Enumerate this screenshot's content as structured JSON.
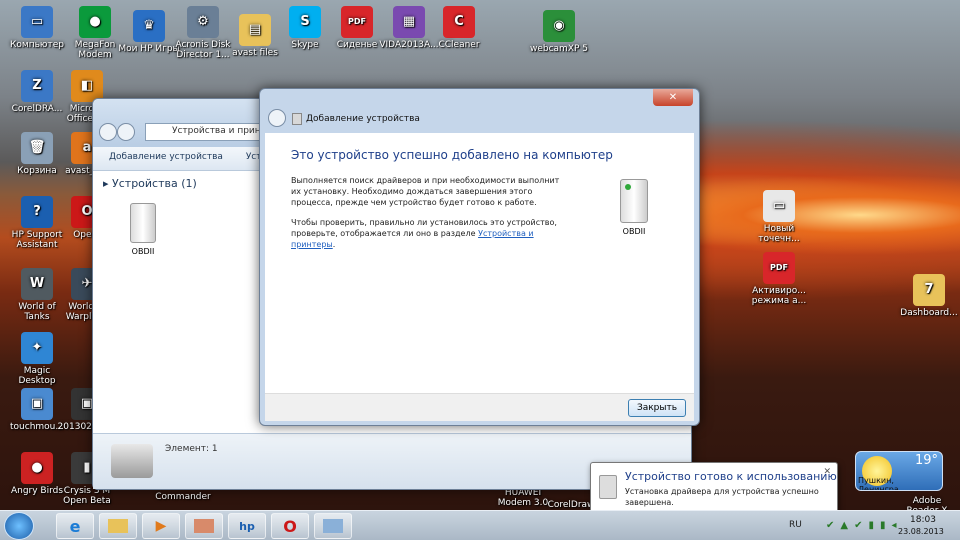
{
  "desktop": {
    "icons": [
      {
        "id": "computer",
        "label": "Компьютер",
        "color": "#3b78c6",
        "glyph": "▭"
      },
      {
        "id": "megafon",
        "label": "MegaFon Modem",
        "color": "#0b9a3c",
        "glyph": "●"
      },
      {
        "id": "myhp",
        "label": "Мои HP Игры",
        "color": "#2a6fc4",
        "glyph": "♛"
      },
      {
        "id": "acronis",
        "label": "Acronis Disk Director 1...",
        "color": "#6a7f96",
        "glyph": "⚙"
      },
      {
        "id": "avast-files",
        "label": "avast files",
        "color": "#e8c25a",
        "glyph": "▤"
      },
      {
        "id": "skype",
        "label": "Skype",
        "color": "#00aff0",
        "glyph": "S"
      },
      {
        "id": "sidenie",
        "label": "Сиденье",
        "color": "#d8262a",
        "glyph": "PDF"
      },
      {
        "id": "vida",
        "label": "VIDA2013A...",
        "color": "#7a4ab0",
        "glyph": "▦"
      },
      {
        "id": "ccleaner",
        "label": "CCleaner",
        "color": "#d8262a",
        "glyph": "C"
      },
      {
        "id": "webcamxp",
        "label": "webcamXP 5",
        "color": "#2b8f3a",
        "glyph": "◉"
      },
      {
        "id": "coreldraw",
        "label": "CorelDRA...",
        "color": "#3b78c6",
        "glyph": "Z"
      },
      {
        "id": "office",
        "label": "Microso Office 20",
        "color": "#e08a1c",
        "glyph": "◧"
      },
      {
        "id": "recycle",
        "label": "Корзина",
        "color": "#8aa0b6",
        "glyph": "🗑"
      },
      {
        "id": "avast",
        "label": "avast_pre",
        "color": "#e0741c",
        "glyph": "a"
      },
      {
        "id": "hpsupport",
        "label": "HP Support Assistant",
        "color": "#1b5fb0",
        "glyph": "?"
      },
      {
        "id": "opera",
        "label": "Opera",
        "color": "#cc1818",
        "glyph": "O"
      },
      {
        "id": "wot",
        "label": "World of Tanks",
        "color": "#505a60",
        "glyph": "W"
      },
      {
        "id": "wowp",
        "label": "World of Warplane",
        "color": "#3a4a5a",
        "glyph": "✈"
      },
      {
        "id": "magic",
        "label": "Magic Desktop",
        "color": "#2f86d4",
        "glyph": "✦"
      },
      {
        "id": "touchmou",
        "label": "touchmou...",
        "color": "#4a8ad0",
        "glyph": "▣"
      },
      {
        "id": "photo2013",
        "label": "20130220_...",
        "color": "#333",
        "glyph": "▣"
      },
      {
        "id": "angry",
        "label": "Angry Birds",
        "color": "#cc2222",
        "glyph": "●"
      },
      {
        "id": "crysis",
        "label": "Crysis 3 M Open Beta",
        "color": "#3a3a3a",
        "glyph": "▮"
      },
      {
        "id": "newdot",
        "label": "Новый точечн...",
        "color": "#e8e8e8",
        "glyph": "▭"
      },
      {
        "id": "activ",
        "label": "Активиро... режима а...",
        "color": "#d8262a",
        "glyph": "PDF"
      },
      {
        "id": "dashboard",
        "label": "Dashboard...",
        "color": "#e8c25a",
        "glyph": "7"
      }
    ],
    "stray_labels": {
      "commander": "Commander",
      "huawei": "HUAWEI Modem 3.0",
      "coreldraw2": "CorelDraw",
      "adobe": "Adobe Reader X"
    }
  },
  "bg_window": {
    "breadcrumb": "Устройства и принтер",
    "toolbar": [
      "Добавление устройства",
      "Установка"
    ],
    "group": "Устройства (1)",
    "device": "OBDII",
    "status": "Элемент: 1"
  },
  "dialog": {
    "title": "Добавление устройства",
    "heading": "Это устройство успешно добавлено на компьютер",
    "p1": "Выполняется поиск драйверов и при необходимости выполнит их установку. Необходимо дождаться завершения этого процесса, прежде чем устройство будет готово к работе.",
    "p2_prefix": "Чтобы проверить, правильно ли установилось это устройство, проверьте, отображается ли оно в разделе ",
    "p2_link": "Устройства и принтеры",
    "p2_suffix": ".",
    "device": "OBDII",
    "close_button": "Закрыть",
    "close_x": "✕"
  },
  "notification": {
    "title": "Устройство готово к использованию",
    "body": "Установка драйвера для устройства успешно завершена."
  },
  "weather": {
    "temp": "19°",
    "city": "Пушкин, Ленингра..."
  },
  "taskbar": {
    "lang": "RU",
    "time": "18:03",
    "date": "23.08.2013"
  }
}
